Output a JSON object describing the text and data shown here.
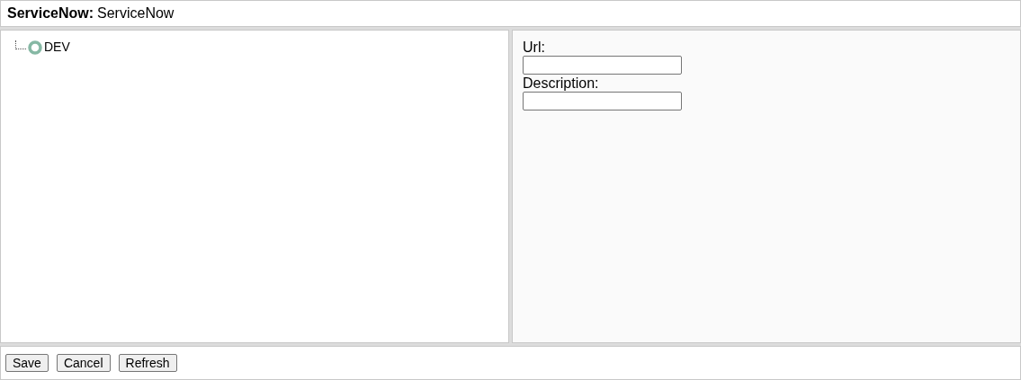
{
  "header": {
    "label": "ServiceNow:",
    "value": "ServiceNow"
  },
  "tree": [
    {
      "label": "DEV"
    }
  ],
  "form": {
    "fields": [
      {
        "label": "Url:"
      },
      {
        "label": "Description:"
      }
    ]
  },
  "buttons": [
    "Save",
    "Cancel",
    "Refresh"
  ]
}
